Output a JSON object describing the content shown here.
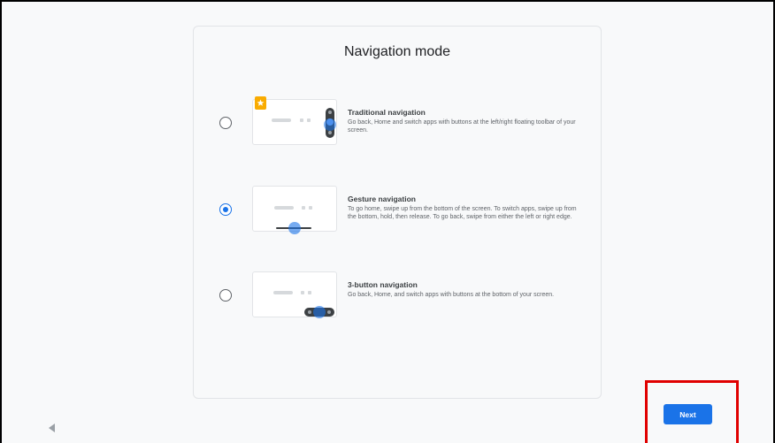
{
  "page": {
    "title": "Navigation mode"
  },
  "options": [
    {
      "title": "Traditional navigation",
      "description": "Go back, Home and switch apps with buttons at the left/right floating toolbar of your screen.",
      "selected": false,
      "icon": "floating-toolbar-illustration"
    },
    {
      "title": "Gesture navigation",
      "description": "To go home, swipe up from the bottom of the screen. To switch apps, swipe up from the bottom, hold, then release. To go back, swipe from either the left or right edge.",
      "selected": true,
      "icon": "gesture-illustration"
    },
    {
      "title": "3-button navigation",
      "description": "Go back, Home, and switch apps with buttons at the bottom of your screen.",
      "selected": false,
      "icon": "three-button-illustration"
    }
  ],
  "footer": {
    "next_label": "Next",
    "back_icon": "back-triangle-icon"
  },
  "colors": {
    "accent": "#1a73e8",
    "highlight": "#e00000",
    "badge": "#f9ab00"
  }
}
